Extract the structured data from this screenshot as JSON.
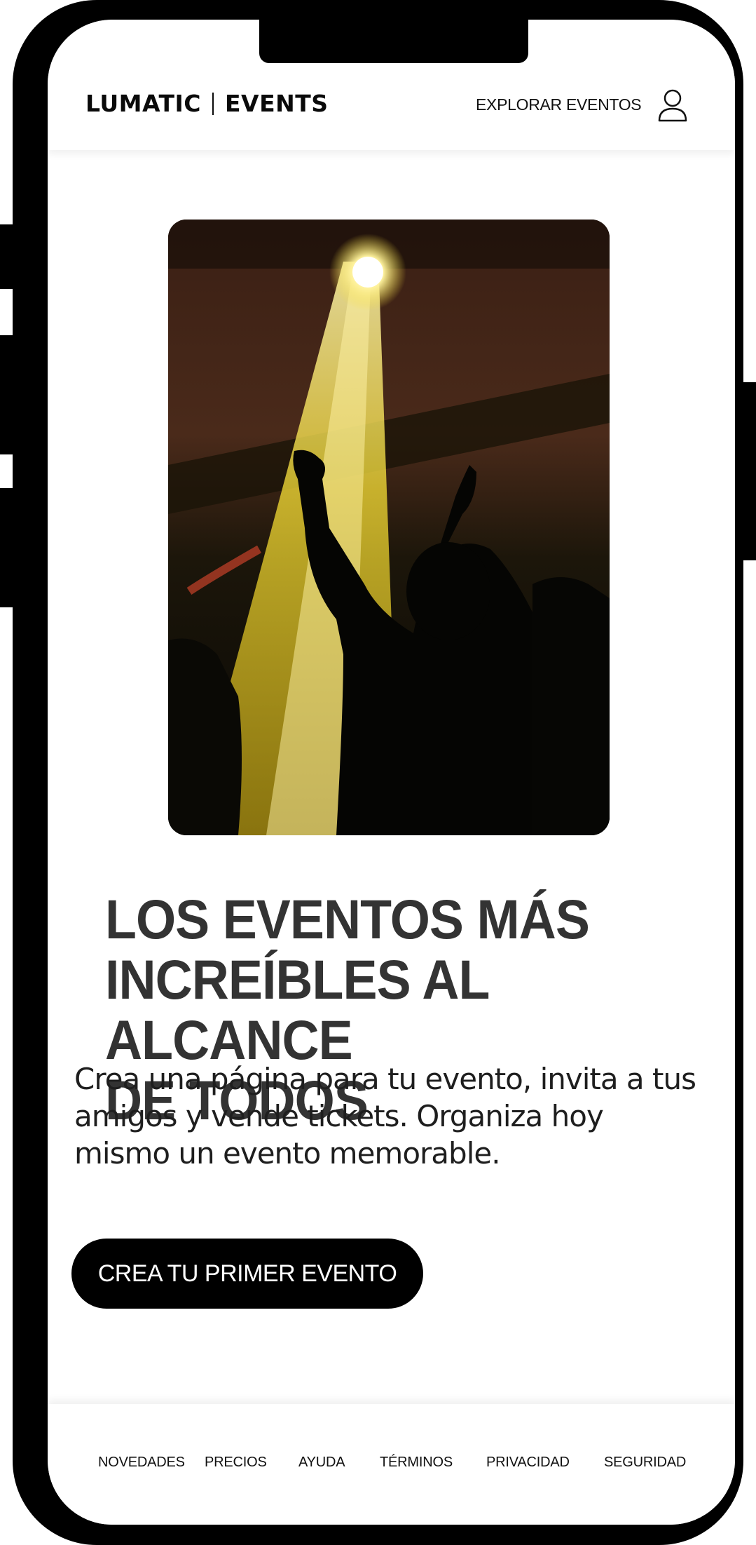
{
  "brand": {
    "left": "LUMATIC",
    "right": "EVENTS"
  },
  "header": {
    "explore_label": "EXPLORAR EVENTOS",
    "user_icon": "user-icon"
  },
  "hero": {
    "image": "concert-spotlight-photo",
    "headline_lines": [
      "LOS EVENTOS MÁS",
      "INCREÍBLES AL ALCANCE",
      "DE TODOS"
    ],
    "subtext_lines": [
      "Crea una página para tu evento, invita a tus",
      "amigos y vende tickets. Organiza hoy",
      "mismo un evento memorable."
    ],
    "cta_label": "CREA TU PRIMER EVENTO"
  },
  "footer": {
    "links": [
      "NOVEDADES",
      "PRECIOS",
      "AYUDA",
      "TÉRMINOS",
      "PRIVACIDAD",
      "SEGURIDAD"
    ]
  },
  "colors": {
    "headline": "#333333",
    "cta_background": "#000000",
    "spotlight": "#f2d82a"
  }
}
